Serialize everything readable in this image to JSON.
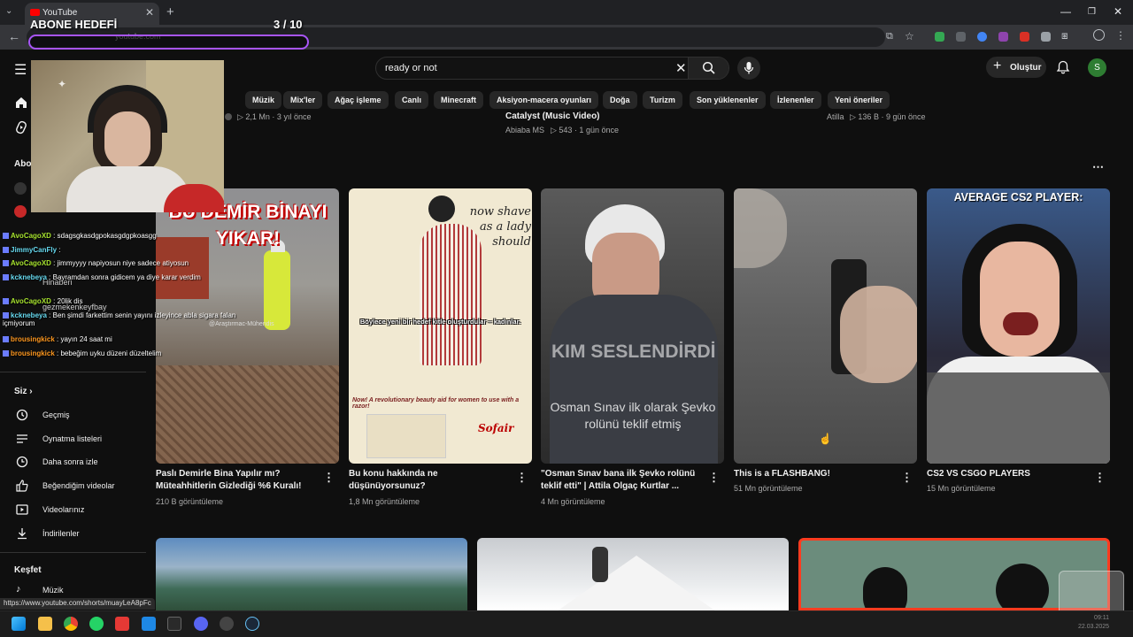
{
  "browser": {
    "tab_title": "YouTube",
    "url": "youtube.com"
  },
  "overlay": {
    "abone_title": "ABONE HEDEFİ",
    "abone_count": "3  / 10",
    "chat": [
      {
        "user": "AvoCagoXD",
        "msg": ": sdagsgkasdgpokasgdgpkoasgg"
      },
      {
        "user": "JimmyCanFly",
        "msg": ":"
      },
      {
        "user": "AvoCagoXD",
        "msg": ": jimmyyyy napiyosun niye sadece atiyosun"
      },
      {
        "user": "kcknebeya",
        "msg": ": Bayramdan sonra gidicem ya diye karar verdim"
      },
      {
        "user": "AvoCagoXD",
        "msg": ": 20lik dis"
      },
      {
        "user": "kcknebeya",
        "msg": ": Ben şimdi farkettim senin yayını izleyince abla sigara falan içmiyorum"
      },
      {
        "user": "brousingkick",
        "msg": ": yayın 24 saat mi"
      },
      {
        "user": "brousingkick",
        "msg": ": bebeğim uyku düzeni düzeltelim"
      }
    ]
  },
  "header": {
    "search_value": "ready or not",
    "create_label": "Oluştur",
    "avatar_letter": "S"
  },
  "chips": [
    "Müzik",
    "Mix'ler",
    "Ağaç işleme",
    "Canlı",
    "Minecraft",
    "Aksiyon-macera oyunları",
    "Doğa",
    "Turizm",
    "Son yüklenenler",
    "İzlenenler",
    "Yeni öneriler"
  ],
  "prev_row": {
    "meta1": "▷ 2,1 Mn · 3 yıl önce",
    "title2": "Catalyst (Music Video)",
    "channel2": "Abiaba MS",
    "meta2": "▷ 543 · 1 gün önce",
    "channel3": "Atilla",
    "meta3": "▷ 136 B · 9 gün önce"
  },
  "sidebar": {
    "abo_head": "Abo",
    "you_head": "Siz",
    "you_items": [
      "Geçmiş",
      "Oynatma listeleri",
      "Daha sonra izle",
      "Beğendiğim videolar",
      "Videolarınız",
      "İndirilenler"
    ],
    "explore_head": "Keşfet",
    "explore_items": [
      "Müzik"
    ],
    "overlapped": [
      "Hinaberi",
      "gezmekenkeyfbay"
    ]
  },
  "videos": [
    {
      "thumb_text": "BU DEMİR BİNAYI YIKAR!",
      "title": "Paslı Demirle Bina Yapılır mı? Müteahhitlerin Gizlediği %6 Kuralı!",
      "meta": "210 B görüntüleme",
      "thumb_watermark": "@Araştırmac-Mühendis"
    },
    {
      "thumb_text": "Böylece yeni bir hedef kitle oluşturdular – kadınlar.",
      "thumb_ad1": "now shave as a lady should",
      "thumb_ad2": "Now! A revolutionary beauty aid for women to use with a razor!",
      "thumb_ad3": "Sofair",
      "title": "Bu konu hakkında ne düşünüyorsunuz?",
      "meta": "1,8 Mn görüntüleme"
    },
    {
      "thumb_text": "KIM SESLENDİRDİ",
      "thumb_sub": "Osman Sınav ilk olarak Şevko rolünü teklif etmiş",
      "title": "\"Osman Sınav bana ilk Şevko rolünü teklif etti\" | Attila Olgaç Kurtlar ...",
      "meta": "4 Mn görüntüleme"
    },
    {
      "thumb_text": "",
      "title": "This is a FLASHBANG!",
      "meta": "51 Mn görüntüleme"
    },
    {
      "thumb_text": "AVERAGE CS2 PLAYER:",
      "title": "CS2 VS CSGO PLAYERS",
      "meta": "15 Mn görüntüleme"
    }
  ],
  "status_url": "https://www.youtube.com/shorts/muayLeA8pFc",
  "clock": {
    "time": "09:11",
    "date": "22.03.2025"
  },
  "colors": {
    "accent": "#ff0000",
    "chip_bg": "#272727",
    "page_bg": "#0f0f0f",
    "avatar": "#2e7d32",
    "abone_border": "#a855f7"
  }
}
